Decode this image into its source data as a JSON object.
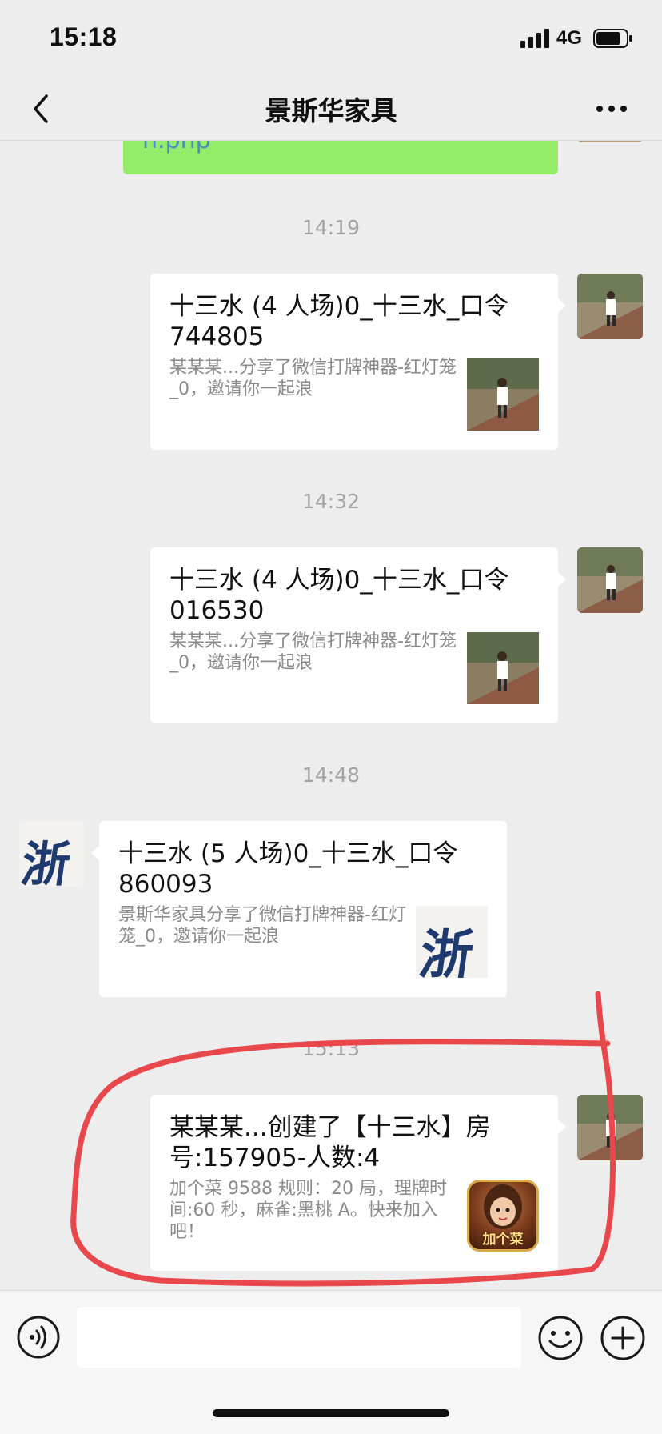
{
  "status_bar": {
    "time": "15:18",
    "network": "4G",
    "icons": [
      "signal-icon",
      "battery-icon"
    ]
  },
  "nav": {
    "title": "景斯华家具",
    "back_icon": "chevron-left-icon",
    "more_icon": "ellipsis-icon"
  },
  "chat": {
    "partial_link_text": "n.php",
    "timestamps": [
      "14:19",
      "14:32",
      "14:48",
      "15:13"
    ],
    "messages": [
      {
        "side": "right",
        "title": "十三水 (4 人场)0_十三水_口令744805",
        "desc": "某某某...分享了微信打牌神器-红灯笼_0，邀请你一起浪",
        "thumb": "photo-thumb"
      },
      {
        "side": "right",
        "title": "十三水 (4 人场)0_十三水_口令016530",
        "desc": "某某某...分享了微信打牌神器-红灯笼_0，邀请你一起浪",
        "thumb": "photo-thumb"
      },
      {
        "side": "left",
        "title": "十三水 (5 人场)0_十三水_口令860093",
        "desc": "景斯华家具分享了微信打牌神器-红灯笼_0，邀请你一起浪",
        "thumb": "calligraphy-thumb",
        "avatar_char": "浙"
      },
      {
        "side": "right",
        "title": "某某某...创建了【十三水】房号:157905-人数:4",
        "desc": "加个菜 9588 规则：20 局，理牌时间:60 秒，麻雀:黑桃 A。快来加入吧！",
        "thumb": "game-icon-thumb",
        "thumb_text": "加个菜"
      }
    ]
  },
  "input_bar": {
    "placeholder": "",
    "icons": [
      "voice-icon",
      "emoji-icon",
      "plus-icon"
    ]
  },
  "colors": {
    "background": "#ededed",
    "sent_link_bubble": "#95ec69",
    "card": "#ffffff",
    "highlight_annotation": "#e8474c"
  }
}
